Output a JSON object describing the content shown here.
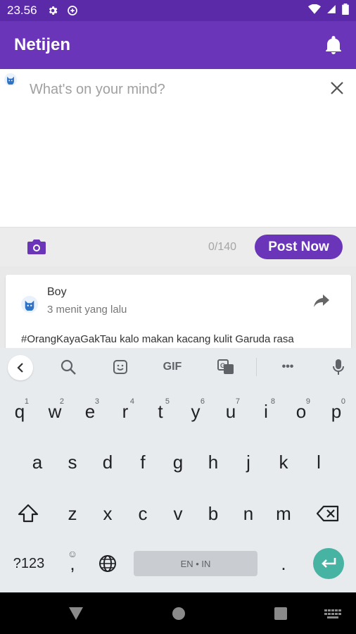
{
  "status_bar": {
    "time": "23.56",
    "icons": [
      "gear-icon",
      "vpn-icon",
      "wifi-icon",
      "signal-icon",
      "battery-icon"
    ]
  },
  "app_bar": {
    "title": "Netijen",
    "icon": "bell-icon"
  },
  "composer": {
    "placeholder": "What's on your mind?",
    "value": "",
    "counter": "0/140",
    "post_label": "Post Now",
    "icons": [
      "cat-avatar-icon",
      "close-icon",
      "camera-icon"
    ]
  },
  "feed": {
    "posts": [
      {
        "author": "Boy",
        "time_ago": "3 menit yang lalu",
        "content": "#OrangKayaGakTau kalo makan kacang kulit Garuda rasa",
        "icons": [
          "cat-avatar-icon",
          "share-icon"
        ]
      }
    ]
  },
  "keyboard": {
    "toolbar": [
      "back-icon",
      "search-icon",
      "sticker-icon",
      "gif-icon",
      "translate-icon",
      "more-icon",
      "mic-icon"
    ],
    "gif_label": "GIF",
    "more_label": "•••",
    "row1": [
      {
        "k": "q",
        "h": "1"
      },
      {
        "k": "w",
        "h": "2"
      },
      {
        "k": "e",
        "h": "3"
      },
      {
        "k": "r",
        "h": "4"
      },
      {
        "k": "t",
        "h": "5"
      },
      {
        "k": "y",
        "h": "6"
      },
      {
        "k": "u",
        "h": "7"
      },
      {
        "k": "i",
        "h": "8"
      },
      {
        "k": "o",
        "h": "9"
      },
      {
        "k": "p",
        "h": "0"
      }
    ],
    "row2": [
      "a",
      "s",
      "d",
      "f",
      "g",
      "h",
      "j",
      "k",
      "l"
    ],
    "row3": [
      "z",
      "x",
      "c",
      "v",
      "b",
      "n",
      "m"
    ],
    "symbols_label": "?123",
    "emoji_label": ",",
    "emoji_hint": "☺",
    "space_label": "EN • IN",
    "period_label": "."
  },
  "nav_bar": {
    "icons": [
      "back-triangle-icon",
      "home-circle-icon",
      "recents-square-icon",
      "keyboard-switch-icon"
    ]
  },
  "colors": {
    "status_bar": "#5a2aa8",
    "primary": "#6a35b8",
    "enter_key": "#47b3a3",
    "keyboard_bg": "#e8ebee"
  }
}
